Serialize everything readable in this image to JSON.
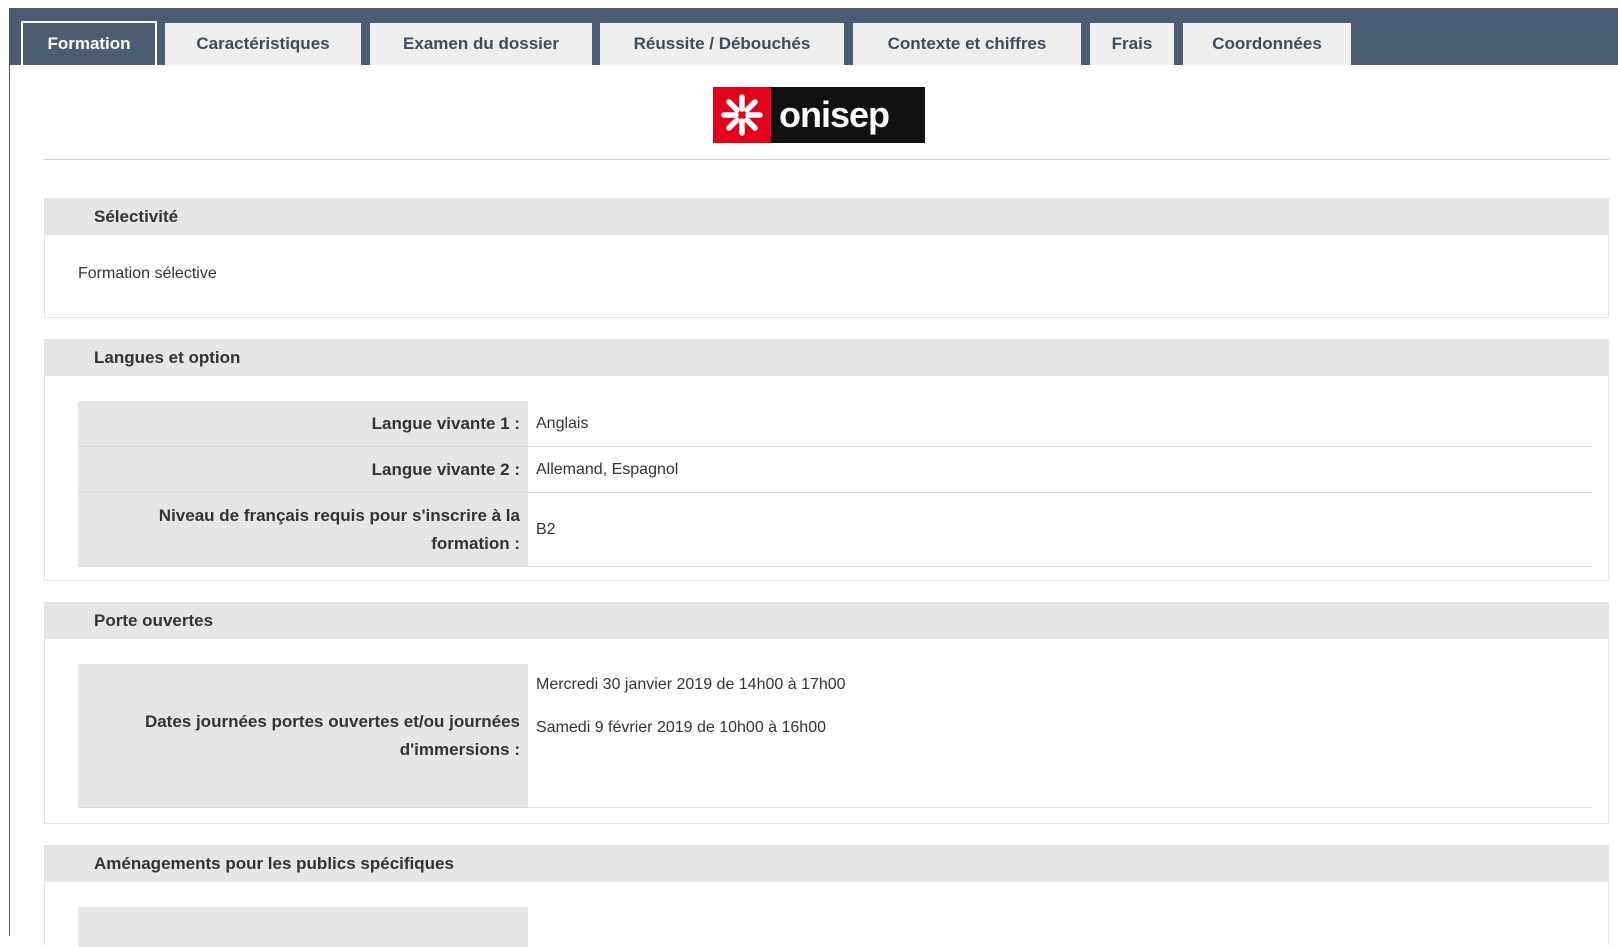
{
  "tabs": [
    {
      "label": "Formation",
      "active": true
    },
    {
      "label": "Caractéristiques",
      "active": false
    },
    {
      "label": "Examen du dossier",
      "active": false
    },
    {
      "label": "Réussite / Débouchés",
      "active": false
    },
    {
      "label": "Contexte et chiffres",
      "active": false
    },
    {
      "label": "Frais",
      "active": false
    },
    {
      "label": "Coordonnées",
      "active": false
    }
  ],
  "logo": {
    "text": "onisep",
    "mark_icon": "asterisk-icon",
    "colors": {
      "mark": "#e2001a",
      "text_bg": "#111111"
    }
  },
  "sections": {
    "selectivite": {
      "title": "Sélectivité",
      "text": "Formation sélective"
    },
    "langues": {
      "title": "Langues et option",
      "rows": [
        {
          "key": "Langue vivante 1 :",
          "value": "Anglais"
        },
        {
          "key": "Langue vivante 2 :",
          "value": "Allemand, Espagnol"
        },
        {
          "key": "Niveau de français requis pour s'inscrire à la formation :",
          "value": "B2"
        }
      ]
    },
    "portes": {
      "title": "Porte ouvertes",
      "rows": [
        {
          "key": "Dates journées portes ouvertes et/ou journées d'immersions :",
          "values": [
            "Mercredi 30 janvier 2019 de 14h00 à 17h00",
            "Samedi 9 février 2019 de 10h00 à 16h00"
          ]
        }
      ]
    },
    "amenagements": {
      "title": "Aménagements pour les publics spécifiques"
    }
  },
  "colors": {
    "header_bar": "#4a5d73",
    "tab_bg": "#eeeeee",
    "section_head": "#e6e6e6"
  }
}
